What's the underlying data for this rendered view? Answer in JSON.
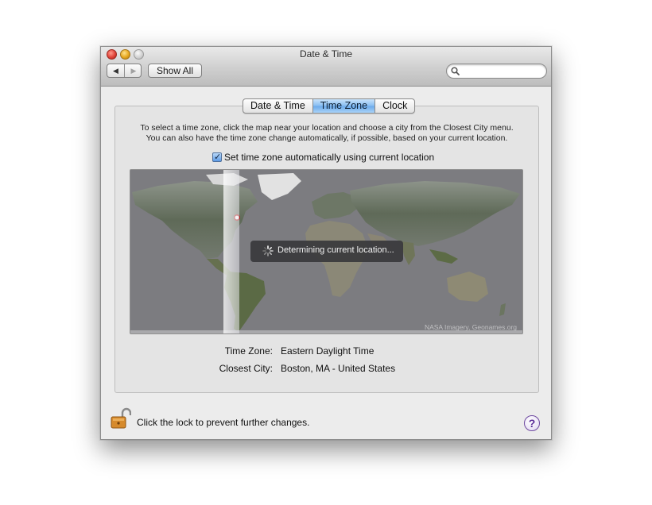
{
  "window": {
    "title": "Date & Time"
  },
  "toolbar": {
    "back_glyph": "◀",
    "forward_glyph": "▶",
    "show_all_label": "Show All",
    "search_placeholder": ""
  },
  "tabs": [
    {
      "label": "Date & Time",
      "selected": false
    },
    {
      "label": "Time Zone",
      "selected": true
    },
    {
      "label": "Clock",
      "selected": false
    }
  ],
  "time_zone": {
    "instructions_line1": "To select a time zone, click the map near your location and choose a city from the Closest City menu.",
    "instructions_line2": "You can also have the time zone change automatically, if possible, based on your current location.",
    "auto_checkbox_label": "Set time zone automatically using current location",
    "auto_checked": true,
    "map_status": "Determining current location...",
    "map_credit": "NASA Imagery, Geonames.org",
    "time_zone_label": "Time Zone:",
    "time_zone_value": "Eastern Daylight Time",
    "closest_city_label": "Closest City:",
    "closest_city_value": "Boston, MA - United States"
  },
  "footer": {
    "lock_text": "Click the lock to prevent further changes.",
    "help_glyph": "?"
  },
  "colors": {
    "accent_tab": "#87bdf2",
    "help_purple": "#5b2c99"
  }
}
